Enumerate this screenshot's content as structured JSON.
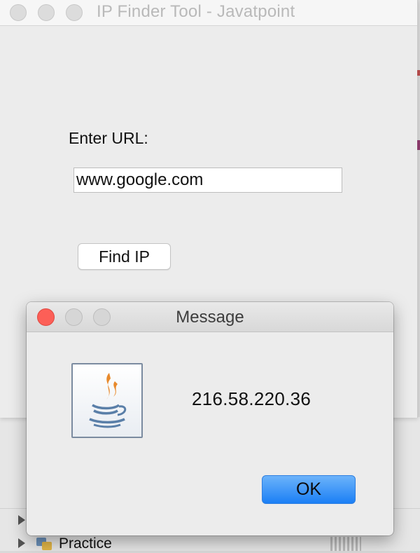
{
  "main_window": {
    "title": "IP Finder Tool - Javatpoint",
    "url_label": "Enter URL:",
    "url_value": "www.google.com",
    "find_button_label": "Find IP"
  },
  "dialog": {
    "title": "Message",
    "message": "216.58.220.36",
    "icon": "java-icon",
    "ok_label": "OK"
  },
  "background": {
    "tree_item_label": "Practice",
    "tree_item_icon": "package-icon"
  },
  "colors": {
    "close_light": "#fc5f57",
    "ok_button": "#1b7ff5"
  }
}
